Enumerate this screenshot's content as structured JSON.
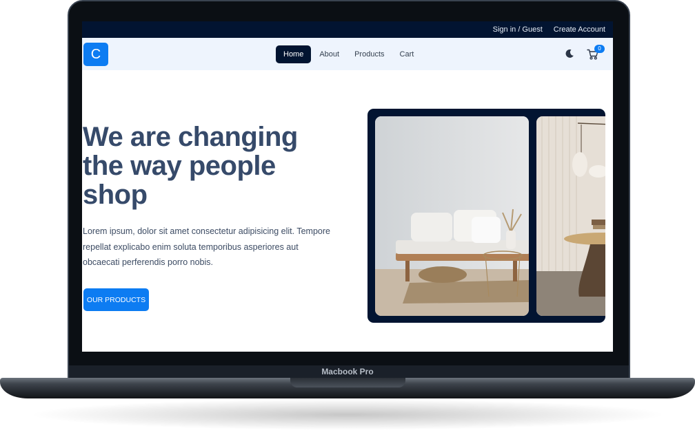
{
  "topbar": {
    "signin_label": "Sign in / Guest",
    "create_account_label": "Create Account"
  },
  "navbar": {
    "logo_text": "C",
    "links": [
      {
        "label": "Home",
        "active": true
      },
      {
        "label": "About"
      },
      {
        "label": "Products"
      },
      {
        "label": "Cart"
      }
    ],
    "cart_count": "0",
    "theme_icon": "moon-icon",
    "cart_icon": "cart-icon"
  },
  "hero": {
    "title": "We are changing the way people shop",
    "description": "Lorem ipsum, dolor sit amet consectetur adipisicing elit. Tempore repellat explicabo enim soluta temporibus asperiores aut obcaecati perferendis porro nobis.",
    "button_label": "OUR PRODUCTS"
  },
  "device": {
    "label": "Macbook Pro"
  },
  "colors": {
    "accent": "#0d7cf2",
    "dark_navy": "#021431",
    "title": "#364a6a"
  }
}
